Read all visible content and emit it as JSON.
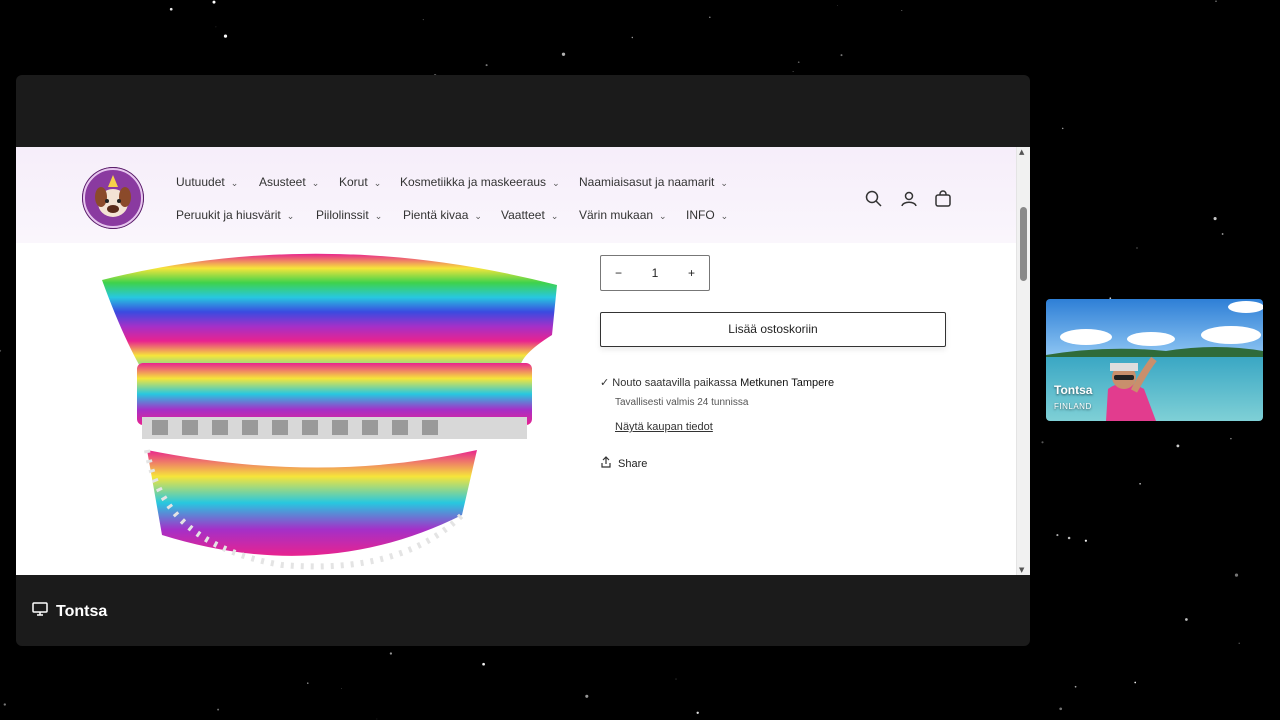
{
  "nav": {
    "items": [
      {
        "label": "Uutuudet"
      },
      {
        "label": "Asusteet"
      },
      {
        "label": "Korut"
      },
      {
        "label": "Kosmetiikka ja maskeeraus"
      },
      {
        "label": "Naamiaisasut ja naamarit"
      },
      {
        "label": "Peruukit ja hiusvärit"
      },
      {
        "label": "Piilolinssit"
      },
      {
        "label": "Pientä kivaa"
      },
      {
        "label": "Vaatteet"
      },
      {
        "label": "Värin mukaan"
      },
      {
        "label": "INFO"
      }
    ],
    "icons": [
      "search-icon",
      "account-icon",
      "cart-icon"
    ]
  },
  "product": {
    "quantity": "1",
    "minus": "−",
    "plus": "+",
    "add_to_cart": "Lisää ostoskoriin",
    "pickup_prefix": "Nouto saatavilla paikassa",
    "pickup_store": "Metkunen Tampere",
    "pickup_time": "Tavallisesti valmis 24 tunnissa",
    "store_info_link": "Näytä kaupan tiedot",
    "share": "Share"
  },
  "presenter": {
    "screen_label": "Tontsa"
  },
  "webcam": {
    "name": "Tontsa",
    "country": "FINLAND"
  },
  "colors": {
    "panel_bg": "#1b1b1b",
    "header_bg": "#f6eefa",
    "logo_purple": "#7b2e8f"
  }
}
